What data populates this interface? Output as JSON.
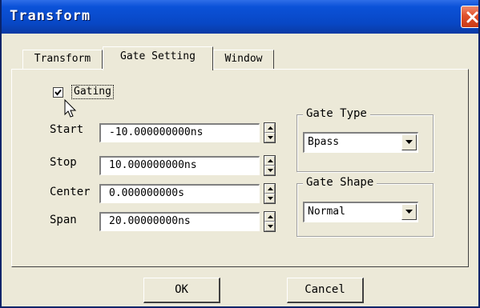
{
  "window": {
    "title": "Transform"
  },
  "tabs": [
    {
      "label": "Transform",
      "active": false
    },
    {
      "label": "Gate Setting",
      "active": true
    },
    {
      "label": "Window",
      "active": false
    }
  ],
  "gating": {
    "label": "Gating",
    "checked": true
  },
  "fields": {
    "start": {
      "label": "Start",
      "value": "-10.000000000ns"
    },
    "stop": {
      "label": "Stop",
      "value": "10.000000000ns"
    },
    "center": {
      "label": "Center",
      "value": "0.000000000s"
    },
    "span": {
      "label": "Span",
      "value": "20.00000000ns"
    }
  },
  "gate_type": {
    "title": "Gate Type",
    "selected": "Bpass"
  },
  "gate_shape": {
    "title": "Gate Shape",
    "selected": "Normal"
  },
  "buttons": {
    "ok": "OK",
    "cancel": "Cancel"
  },
  "colors": {
    "title_bar": "#0b52d8",
    "close_button": "#e0502a",
    "dialog_bg": "#ece9d8"
  }
}
